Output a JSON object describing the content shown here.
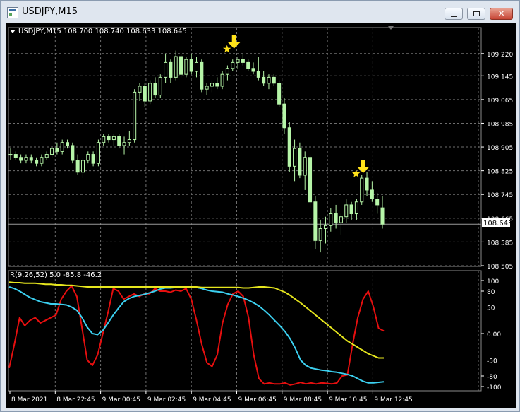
{
  "window": {
    "title": "USDJPY,M15",
    "minimize_icon": "minimize-icon",
    "maximize_icon": "maximize-icon",
    "close_icon": "close-icon",
    "close_glyph": "✕"
  },
  "price_panel": {
    "header": "USDJPY,M15  108.700 108.740 108.633 108.645",
    "header_marker": "dropdown-triangle-icon",
    "price_ticks": [
      "109.220",
      "109.145",
      "109.065",
      "108.985",
      "108.905",
      "108.825",
      "108.745",
      "108.665",
      "108.585",
      "108.505"
    ],
    "current_price_label": "108.645",
    "signal_icon": "arrow-down-star-icon"
  },
  "indicator_panel": {
    "header": "R(9,26,52) 5.0 -85.8 -46.2",
    "ticks": [
      "100",
      "80",
      "50",
      "0.00",
      "-50",
      "-80",
      "-100"
    ]
  },
  "time_axis": {
    "labels": [
      "8 Mar 2021",
      "8 Mar 22:45",
      "9 Mar 00:45",
      "9 Mar 02:45",
      "9 Mar 04:45",
      "9 Mar 06:45",
      "9 Mar 08:45",
      "9 Mar 10:45",
      "9 Mar 12:45"
    ]
  },
  "colors": {
    "background": "#000000",
    "grid": "#6e6e6e",
    "candle": "#b6f5a8",
    "red_line": "#e60f0f",
    "cyan_line": "#3cd0f0",
    "yellow_line": "#e6e61e",
    "signal": "#ffe21a"
  },
  "chart_data": [
    {
      "type": "candlestick",
      "symbol": "USDJPY",
      "timeframe": "M15",
      "last_bar": {
        "open": 108.7,
        "high": 108.74,
        "low": 108.633,
        "close": 108.645
      },
      "ylim": [
        108.505,
        109.26
      ],
      "x": [
        "8 Mar 2021",
        "8 Mar 22:45",
        "9 Mar 00:45",
        "9 Mar 02:45",
        "9 Mar 04:45",
        "9 Mar 06:45",
        "9 Mar 08:45",
        "9 Mar 10:45",
        "9 Mar 12:45"
      ],
      "ohlc": [
        [
          108.88,
          108.9,
          108.86,
          108.88
        ],
        [
          108.88,
          108.89,
          108.86,
          108.87
        ],
        [
          108.87,
          108.88,
          108.85,
          108.86
        ],
        [
          108.86,
          108.88,
          108.85,
          108.87
        ],
        [
          108.87,
          108.88,
          108.85,
          108.86
        ],
        [
          108.86,
          108.87,
          108.84,
          108.85
        ],
        [
          108.85,
          108.88,
          108.84,
          108.87
        ],
        [
          108.87,
          108.89,
          108.86,
          108.88
        ],
        [
          108.88,
          108.91,
          108.87,
          108.9
        ],
        [
          108.9,
          108.92,
          108.88,
          108.89
        ],
        [
          108.89,
          108.93,
          108.88,
          108.92
        ],
        [
          108.92,
          108.93,
          108.9,
          108.91
        ],
        [
          108.91,
          108.92,
          108.85,
          108.86
        ],
        [
          108.86,
          108.88,
          108.81,
          108.82
        ],
        [
          108.82,
          108.87,
          108.8,
          108.86
        ],
        [
          108.86,
          108.89,
          108.85,
          108.88
        ],
        [
          108.88,
          108.89,
          108.84,
          108.85
        ],
        [
          108.85,
          108.93,
          108.84,
          108.92
        ],
        [
          108.92,
          108.95,
          108.91,
          108.94
        ],
        [
          108.94,
          108.95,
          108.92,
          108.93
        ],
        [
          108.93,
          108.95,
          108.91,
          108.94
        ],
        [
          108.94,
          108.95,
          108.9,
          108.91
        ],
        [
          108.91,
          108.94,
          108.88,
          108.92
        ],
        [
          108.92,
          108.96,
          108.91,
          108.93
        ],
        [
          108.93,
          109.1,
          108.92,
          109.09
        ],
        [
          109.09,
          109.12,
          109.06,
          109.11
        ],
        [
          109.11,
          109.12,
          109.04,
          109.06
        ],
        [
          109.06,
          109.13,
          109.05,
          109.12
        ],
        [
          109.12,
          109.14,
          109.07,
          109.08
        ],
        [
          109.08,
          109.15,
          109.07,
          109.14
        ],
        [
          109.14,
          109.22,
          109.12,
          109.19
        ],
        [
          109.19,
          109.2,
          109.12,
          109.14
        ],
        [
          109.14,
          109.23,
          109.13,
          109.21
        ],
        [
          109.21,
          109.22,
          109.14,
          109.15
        ],
        [
          109.15,
          109.21,
          109.14,
          109.2
        ],
        [
          109.2,
          109.22,
          109.15,
          109.16
        ],
        [
          109.16,
          109.21,
          109.14,
          109.19
        ],
        [
          109.19,
          109.2,
          109.09,
          109.1
        ],
        [
          109.1,
          109.12,
          109.08,
          109.11
        ],
        [
          109.11,
          109.13,
          109.09,
          109.12
        ],
        [
          109.12,
          109.14,
          109.1,
          109.11
        ],
        [
          109.11,
          109.16,
          109.1,
          109.15
        ],
        [
          109.15,
          109.18,
          109.13,
          109.17
        ],
        [
          109.17,
          109.2,
          109.16,
          109.19
        ],
        [
          109.19,
          109.21,
          109.17,
          109.2
        ],
        [
          109.2,
          109.22,
          109.18,
          109.19
        ],
        [
          109.19,
          109.2,
          109.16,
          109.17
        ],
        [
          109.17,
          109.19,
          109.15,
          109.16
        ],
        [
          109.16,
          109.21,
          109.13,
          109.14
        ],
        [
          109.14,
          109.16,
          109.11,
          109.12
        ],
        [
          109.12,
          109.15,
          109.1,
          109.14
        ],
        [
          109.14,
          109.15,
          109.11,
          109.12
        ],
        [
          109.12,
          109.13,
          109.04,
          109.05
        ],
        [
          109.05,
          109.07,
          108.95,
          108.97
        ],
        [
          108.97,
          108.99,
          108.82,
          108.84
        ],
        [
          108.84,
          108.93,
          108.79,
          108.9
        ],
        [
          108.9,
          108.92,
          108.8,
          108.81
        ],
        [
          108.81,
          108.89,
          108.76,
          108.87
        ],
        [
          108.87,
          108.88,
          108.7,
          108.72
        ],
        [
          108.72,
          108.74,
          108.56,
          108.59
        ],
        [
          108.59,
          108.66,
          108.55,
          108.63
        ],
        [
          108.63,
          108.67,
          108.58,
          108.64
        ],
        [
          108.64,
          108.7,
          108.62,
          108.68
        ],
        [
          108.68,
          108.71,
          108.63,
          108.65
        ],
        [
          108.65,
          108.68,
          108.61,
          108.67
        ],
        [
          108.67,
          108.73,
          108.65,
          108.71
        ],
        [
          108.71,
          108.72,
          108.66,
          108.68
        ],
        [
          108.68,
          108.73,
          108.66,
          108.72
        ],
        [
          108.72,
          108.81,
          108.71,
          108.8
        ],
        [
          108.8,
          108.82,
          108.74,
          108.76
        ],
        [
          108.76,
          108.79,
          108.72,
          108.73
        ],
        [
          108.73,
          108.75,
          108.68,
          108.71
        ],
        [
          108.7,
          108.74,
          108.63,
          108.645
        ]
      ],
      "signals": [
        {
          "type": "sell",
          "at": "9 Mar 06:45",
          "price": 109.23
        },
        {
          "type": "sell",
          "at": "9 Mar 12:00",
          "price": 108.81
        }
      ]
    },
    {
      "type": "line",
      "title": "R(9,26,52)",
      "values_shown": [
        5.0,
        -85.8,
        -46.2
      ],
      "ylim": [
        -100,
        100
      ],
      "yticks": [
        100,
        80,
        50,
        0,
        -50,
        -80,
        -100
      ],
      "series": [
        {
          "color": "#e60f0f",
          "values": [
            -65,
            -20,
            30,
            15,
            25,
            30,
            20,
            25,
            30,
            35,
            65,
            80,
            90,
            70,
            10,
            -50,
            -60,
            -40,
            0,
            40,
            85,
            80,
            65,
            70,
            75,
            70,
            75,
            75,
            85,
            80,
            80,
            78,
            82,
            80,
            85,
            65,
            25,
            -20,
            -55,
            -62,
            -40,
            20,
            55,
            75,
            80,
            70,
            30,
            -40,
            -85,
            -95,
            -93,
            -95,
            -95,
            -93,
            -97,
            -95,
            -92,
            -95,
            -93,
            -95,
            -93,
            -94,
            -95,
            -93,
            -80,
            -78,
            -20,
            30,
            65,
            80,
            50,
            10,
            5
          ]
        },
        {
          "color": "#3cd0f0",
          "values": [
            88,
            85,
            80,
            74,
            68,
            64,
            60,
            58,
            56,
            56,
            55,
            54,
            50,
            44,
            30,
            12,
            0,
            -2,
            6,
            20,
            35,
            48,
            60,
            66,
            70,
            72,
            74,
            77,
            80,
            84,
            86,
            86,
            87,
            87,
            88,
            88,
            87,
            85,
            82,
            80,
            79,
            78,
            75,
            73,
            70,
            67,
            63,
            58,
            52,
            44,
            35,
            25,
            15,
            4,
            -10,
            -28,
            -50,
            -60,
            -65,
            -67,
            -69,
            -70,
            -72,
            -73,
            -75,
            -77,
            -80,
            -85,
            -90,
            -93,
            -93,
            -92,
            -91
          ]
        },
        {
          "color": "#e6e61e",
          "values": [
            97,
            96,
            96,
            95,
            95,
            95,
            94,
            93,
            93,
            92,
            92,
            91,
            91,
            90,
            89,
            88,
            88,
            88,
            88,
            88,
            88,
            88,
            88,
            88,
            88,
            88,
            88,
            88,
            88,
            88,
            88,
            88,
            88,
            88,
            88,
            88,
            88,
            87,
            87,
            87,
            87,
            87,
            87,
            87,
            87,
            86,
            86,
            87,
            88,
            88,
            87,
            86,
            82,
            78,
            72,
            65,
            58,
            50,
            42,
            34,
            26,
            18,
            10,
            2,
            -6,
            -14,
            -20,
            -26,
            -32,
            -38,
            -42,
            -46,
            -46
          ]
        }
      ]
    }
  ]
}
